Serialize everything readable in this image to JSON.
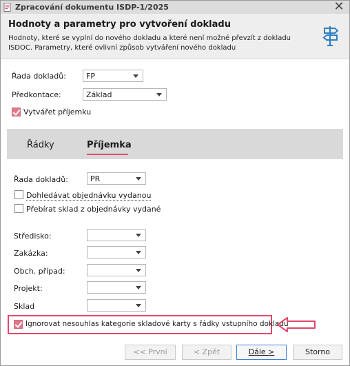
{
  "window": {
    "title": "Zpracování dokumentu ISDP-1/2025",
    "close_glyph": "✕"
  },
  "header": {
    "title": "Hodnoty a parametry pro vytvoření dokladu",
    "description": "Hodnoty, které se vyplní do nového dokladu a které není možné převzít z dokladu ISDOC. Parametry, které ovlivní způsob vytváření nového dokladu",
    "icon": "signpost-icon"
  },
  "top_form": {
    "rada_label": "Řada dokladů:",
    "rada_value": "FP",
    "predkontace_label": "Předkontace:",
    "predkontace_value": "Základ",
    "vytvaret_label": "Vytvářet příjemku",
    "vytvaret_checked": true
  },
  "tabs": [
    {
      "label": "Řádky",
      "active": false
    },
    {
      "label": "Příjemka",
      "active": true
    }
  ],
  "prijemka": {
    "rada_label": "Řada dokladů:",
    "rada_value": "PR",
    "dohledavat_label": "Dohledávat objednávku vydanou",
    "dohledavat_checked": false,
    "prebirat_label": "Přebírat sklad z objednávky vydané",
    "prebirat_checked": false,
    "stredisko_label": "Středisko:",
    "zakazka_label": "Zakázka:",
    "obch_pripad_label": "Obch. případ:",
    "projekt_label": "Projekt:",
    "sklad_label": "Sklad",
    "ignorovat_label": "Ignorovat nesouhlas kategorie skladové karty s řádky vstupního dokladu",
    "ignorovat_checked": true
  },
  "buttons": {
    "first": "<< První",
    "prev": "< Zpět",
    "next": "Dále >",
    "cancel": "Storno"
  },
  "colors": {
    "accent": "#e0486a",
    "checkbox_on": "#e07a8a",
    "primary_border": "#3c7fd1"
  }
}
